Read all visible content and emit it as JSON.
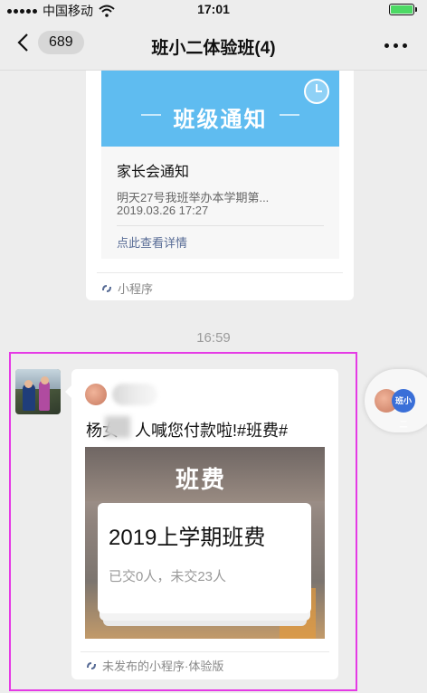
{
  "status_bar": {
    "carrier": "中国移动",
    "time": "17:01",
    "signal_icon": "signal-dots-icon",
    "wifi_icon": "wifi-icon",
    "battery_icon": "battery-icon",
    "battery_level": 1.0,
    "battery_color": "#4cd964"
  },
  "nav": {
    "back_icon": "chevron-left-icon",
    "unread_count": "689",
    "title": "班小二体验班(4)",
    "more_icon": "more-dots-icon"
  },
  "notice_card": {
    "banner_text": "班级通知",
    "banner_color": "#5fbcf0",
    "clock_icon": "clock-icon",
    "title": "家长会通知",
    "description": "明天27号我班举办本学期第...",
    "date": "2019.03.26 17:27",
    "link": "点此查看详情",
    "footer_icon": "mini-program-icon",
    "footer_text": "小程序"
  },
  "timestamp": "16:59",
  "payment_card": {
    "title_prefix": "杨女",
    "title_suffix": "人喊您付款啦!#班费#",
    "poster_title": "班费",
    "fee_title": "2019上学期班费",
    "fee_status": "已交0人，未交23人",
    "footer_icon": "mini-program-icon",
    "footer_text": "未发布的小程序·体验版"
  },
  "floating_badge_text": "班小二",
  "highlight_color": "#e53ae5"
}
